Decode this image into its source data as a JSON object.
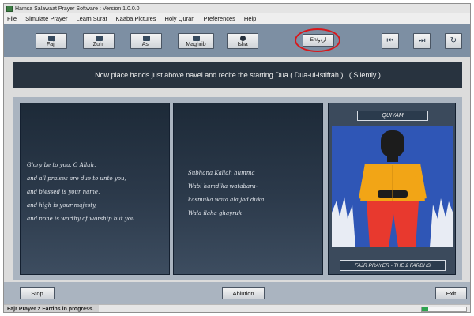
{
  "window": {
    "title": "Hamsa Salawaat Prayer Software : Version 1.0.0.0"
  },
  "menu": [
    "File",
    "Simulate Prayer",
    "Learn Surat",
    "Kaaba Pictures",
    "Holy Quran",
    "Preferences",
    "Help"
  ],
  "toolbar": {
    "prayers": [
      "Fajr",
      "Zuhr",
      "Asr",
      "Maghrib",
      "Isha"
    ],
    "language_label": "En/اردو",
    "nav": {
      "back_icon": "skip-back-icon",
      "forward_icon": "skip-forward-icon",
      "refresh_icon": "refresh-icon"
    },
    "highlight_color": "#d8171b"
  },
  "instruction": {
    "text": "Now place hands just above navel and recite the starting Dua ( Dua-ul-Istiftah ) . ( Silently )"
  },
  "english_text": [
    "Glory be to you, O Allah,",
    "and all praises are due to unto you,",
    "and blessed is your name,",
    "and high is your majesty,",
    "and none is worthy of worship but you."
  ],
  "transliteration": [
    "Subhana Kallah humma",
    "Wabi hamdika watabara-",
    "kasmuka wata ala jad duka",
    "Wala ilaha ghayruk"
  ],
  "posture": {
    "label": "QUIYAM",
    "caption": "FAJR PRAYER - THE 2 FARDHS"
  },
  "bottom": {
    "stop": "Stop",
    "ablution": "Ablution",
    "exit": "Exit"
  },
  "status": {
    "text": "Fajr Prayer 2 Fardhs in progress.",
    "progress": 0.15
  }
}
